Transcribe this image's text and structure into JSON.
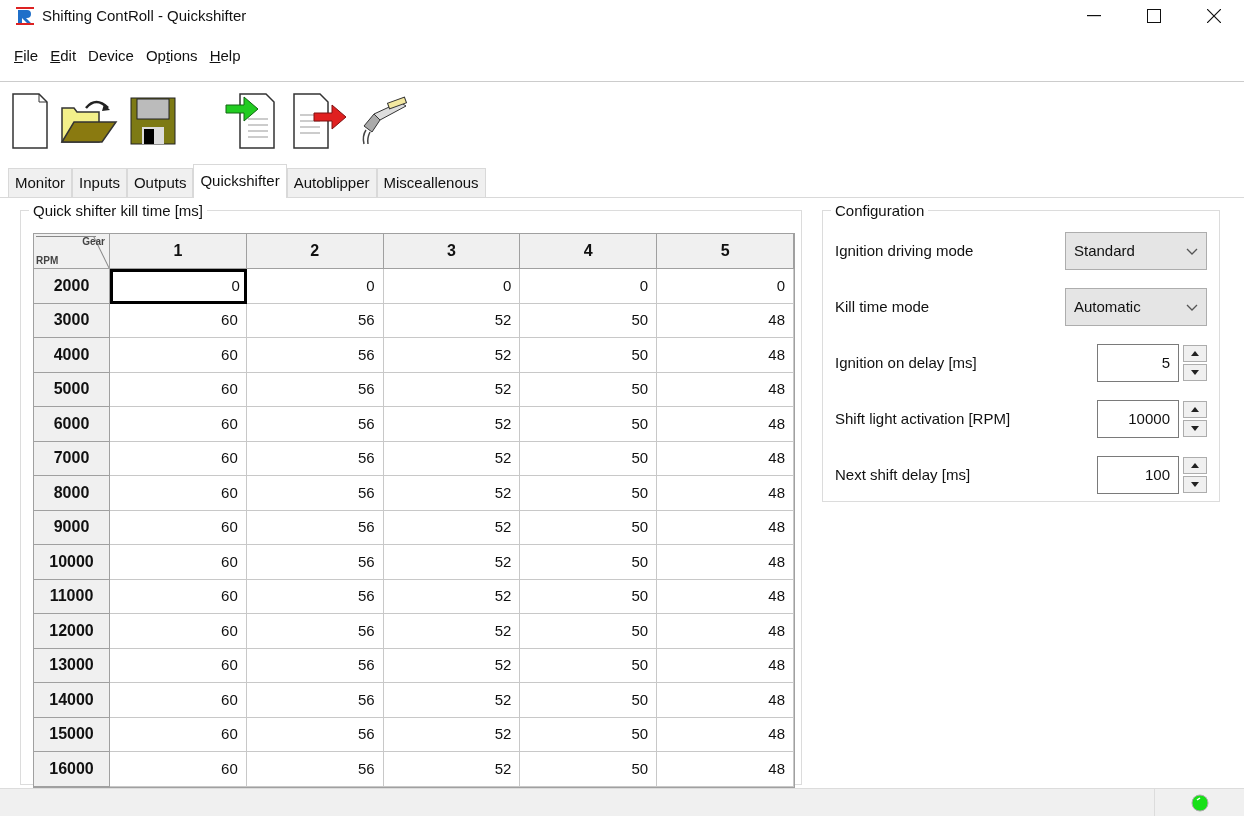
{
  "window": {
    "title": "Shifting ContRoll - Quickshifter"
  },
  "menu": [
    {
      "parts": [
        {
          "text": "F",
          "underline": true
        },
        {
          "text": "ile",
          "underline": false
        }
      ]
    },
    {
      "parts": [
        {
          "text": "E",
          "underline": true
        },
        {
          "text": "dit",
          "underline": false
        }
      ]
    },
    {
      "parts": [
        {
          "text": "Device",
          "underline": false
        }
      ]
    },
    {
      "parts": [
        {
          "text": "Op",
          "underline": false
        },
        {
          "text": "t",
          "underline": true
        },
        {
          "text": "ions",
          "underline": false
        }
      ]
    },
    {
      "parts": [
        {
          "text": "H",
          "underline": true
        },
        {
          "text": "elp",
          "underline": false
        }
      ]
    }
  ],
  "tabs": [
    {
      "label": "Monitor",
      "selected": false
    },
    {
      "label": "Inputs",
      "selected": false
    },
    {
      "label": "Outputs",
      "selected": false
    },
    {
      "label": "Quickshifter",
      "selected": true
    },
    {
      "label": "Autoblipper",
      "selected": false
    },
    {
      "label": "Misceallenous",
      "selected": false
    }
  ],
  "kill_time": {
    "title": "Quick shifter kill time [ms]",
    "corner_top": "Gear",
    "corner_bottom": "RPM",
    "columns": [
      "1",
      "2",
      "3",
      "4",
      "5"
    ],
    "rows": [
      {
        "rpm": "2000",
        "cells": [
          {
            "value": "0",
            "selected": true
          },
          {
            "value": "0",
            "selected": false
          },
          {
            "value": "0",
            "selected": false
          },
          {
            "value": "0",
            "selected": false
          },
          {
            "value": "0",
            "selected": false
          }
        ]
      },
      {
        "rpm": "3000",
        "cells": [
          {
            "value": "60",
            "selected": false
          },
          {
            "value": "56",
            "selected": false
          },
          {
            "value": "52",
            "selected": false
          },
          {
            "value": "50",
            "selected": false
          },
          {
            "value": "48",
            "selected": false
          }
        ]
      },
      {
        "rpm": "4000",
        "cells": [
          {
            "value": "60",
            "selected": false
          },
          {
            "value": "56",
            "selected": false
          },
          {
            "value": "52",
            "selected": false
          },
          {
            "value": "50",
            "selected": false
          },
          {
            "value": "48",
            "selected": false
          }
        ]
      },
      {
        "rpm": "5000",
        "cells": [
          {
            "value": "60",
            "selected": false
          },
          {
            "value": "56",
            "selected": false
          },
          {
            "value": "52",
            "selected": false
          },
          {
            "value": "50",
            "selected": false
          },
          {
            "value": "48",
            "selected": false
          }
        ]
      },
      {
        "rpm": "6000",
        "cells": [
          {
            "value": "60",
            "selected": false
          },
          {
            "value": "56",
            "selected": false
          },
          {
            "value": "52",
            "selected": false
          },
          {
            "value": "50",
            "selected": false
          },
          {
            "value": "48",
            "selected": false
          }
        ]
      },
      {
        "rpm": "7000",
        "cells": [
          {
            "value": "60",
            "selected": false
          },
          {
            "value": "56",
            "selected": false
          },
          {
            "value": "52",
            "selected": false
          },
          {
            "value": "50",
            "selected": false
          },
          {
            "value": "48",
            "selected": false
          }
        ]
      },
      {
        "rpm": "8000",
        "cells": [
          {
            "value": "60",
            "selected": false
          },
          {
            "value": "56",
            "selected": false
          },
          {
            "value": "52",
            "selected": false
          },
          {
            "value": "50",
            "selected": false
          },
          {
            "value": "48",
            "selected": false
          }
        ]
      },
      {
        "rpm": "9000",
        "cells": [
          {
            "value": "60",
            "selected": false
          },
          {
            "value": "56",
            "selected": false
          },
          {
            "value": "52",
            "selected": false
          },
          {
            "value": "50",
            "selected": false
          },
          {
            "value": "48",
            "selected": false
          }
        ]
      },
      {
        "rpm": "10000",
        "cells": [
          {
            "value": "60",
            "selected": false
          },
          {
            "value": "56",
            "selected": false
          },
          {
            "value": "52",
            "selected": false
          },
          {
            "value": "50",
            "selected": false
          },
          {
            "value": "48",
            "selected": false
          }
        ]
      },
      {
        "rpm": "11000",
        "cells": [
          {
            "value": "60",
            "selected": false
          },
          {
            "value": "56",
            "selected": false
          },
          {
            "value": "52",
            "selected": false
          },
          {
            "value": "50",
            "selected": false
          },
          {
            "value": "48",
            "selected": false
          }
        ]
      },
      {
        "rpm": "12000",
        "cells": [
          {
            "value": "60",
            "selected": false
          },
          {
            "value": "56",
            "selected": false
          },
          {
            "value": "52",
            "selected": false
          },
          {
            "value": "50",
            "selected": false
          },
          {
            "value": "48",
            "selected": false
          }
        ]
      },
      {
        "rpm": "13000",
        "cells": [
          {
            "value": "60",
            "selected": false
          },
          {
            "value": "56",
            "selected": false
          },
          {
            "value": "52",
            "selected": false
          },
          {
            "value": "50",
            "selected": false
          },
          {
            "value": "48",
            "selected": false
          }
        ]
      },
      {
        "rpm": "14000",
        "cells": [
          {
            "value": "60",
            "selected": false
          },
          {
            "value": "56",
            "selected": false
          },
          {
            "value": "52",
            "selected": false
          },
          {
            "value": "50",
            "selected": false
          },
          {
            "value": "48",
            "selected": false
          }
        ]
      },
      {
        "rpm": "15000",
        "cells": [
          {
            "value": "60",
            "selected": false
          },
          {
            "value": "56",
            "selected": false
          },
          {
            "value": "52",
            "selected": false
          },
          {
            "value": "50",
            "selected": false
          },
          {
            "value": "48",
            "selected": false
          }
        ]
      },
      {
        "rpm": "16000",
        "cells": [
          {
            "value": "60",
            "selected": false
          },
          {
            "value": "56",
            "selected": false
          },
          {
            "value": "52",
            "selected": false
          },
          {
            "value": "50",
            "selected": false
          },
          {
            "value": "48",
            "selected": false
          }
        ]
      }
    ]
  },
  "configuration": {
    "title": "Configuration",
    "items": [
      {
        "kind": "combo",
        "label": "Ignition driving mode",
        "value": "Standard"
      },
      {
        "kind": "combo",
        "label": "Kill time mode",
        "value": "Automatic"
      },
      {
        "kind": "spin",
        "label": "Ignition on delay [ms]",
        "value": "5"
      },
      {
        "kind": "spin",
        "label": "Shift light activation [RPM]",
        "value": "10000"
      },
      {
        "kind": "spin",
        "label": "Next shift delay [ms]",
        "value": "100"
      }
    ]
  },
  "status_bar": {
    "connected": true
  }
}
